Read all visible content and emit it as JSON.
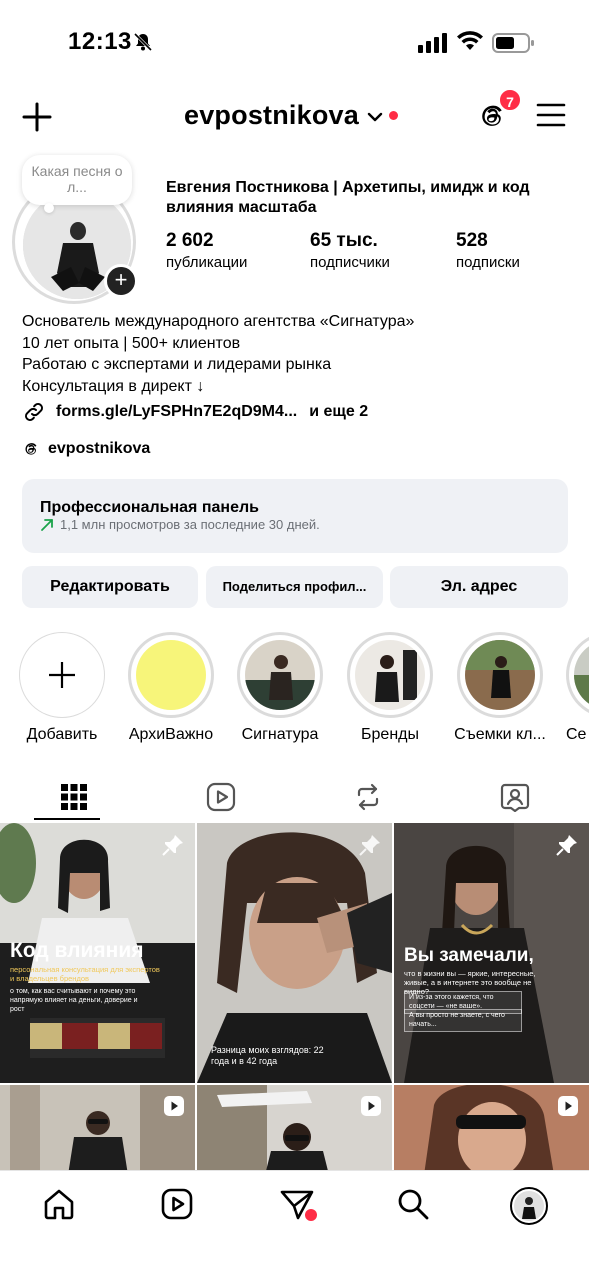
{
  "status_bar": {
    "time": "12:13"
  },
  "header": {
    "username": "evpostnikova",
    "threads_badge": "7"
  },
  "profile": {
    "note": "Какая песня о л...",
    "full_name": "Евгения Постникова | Архетипы, имидж и код влияния масштаба",
    "stats": [
      {
        "value": "2 602",
        "label": "публикации"
      },
      {
        "value": "65 тыс.",
        "label": "подписчики"
      },
      {
        "value": "528",
        "label": "подписки"
      }
    ],
    "bio_lines": [
      "Основатель международного агентства «Сигнатура»",
      "10 лет опыта | 500+ клиентов",
      "Работаю с экспертами и лидерами рынка",
      "Консультация в директ ↓"
    ],
    "link": "forms.gle/LyFSPHn7E2qD9M4...",
    "link_more": "и еще 2",
    "threads_handle": "evpostnikova"
  },
  "pro_panel": {
    "title": "Профессиональная панель",
    "subtitle": "1,1 млн просмотров за последние 30 дней."
  },
  "buttons": {
    "edit": "Редактировать",
    "share": "Поделиться профил...",
    "email": "Эл. адрес"
  },
  "highlights": [
    {
      "label": "Добавить"
    },
    {
      "label": "АрхиВажно"
    },
    {
      "label": "Сигнатура"
    },
    {
      "label": "Бренды"
    },
    {
      "label": "Съемки кл..."
    },
    {
      "label": "Се"
    }
  ],
  "posts": [
    {
      "title": "Код влияния",
      "subtitle": "персональная консультация для экспертов и владельцев брендов",
      "body": "о том, как вас считывают и почему это напрямую влияет на деньги, доверие и рост"
    },
    {
      "caption": "Разница моих взглядов: 22 года и в 42 года"
    },
    {
      "title": "Вы замечали,",
      "subtitle": "что в жизни вы — яркие, интересные, живые, а в интернете это вообще не видно?",
      "box1": "И из-за этого кажется, что соцсети — «не ваше».",
      "box2": "А вы просто не знаете, с чего начать..."
    }
  ],
  "colors": {
    "accent_red": "#ff2d46",
    "panel_bg": "#eff1f5",
    "highlight_yellow": "#f7f57a"
  }
}
